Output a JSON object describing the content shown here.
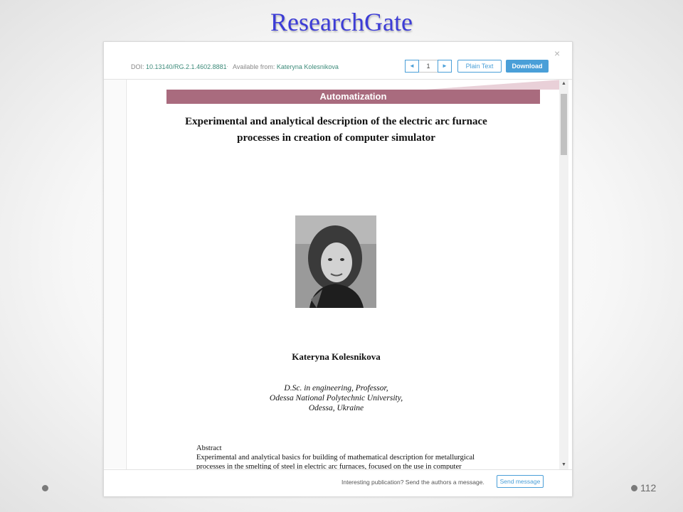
{
  "slide": {
    "title": "ResearchGate",
    "page_number": "112"
  },
  "viewer": {
    "doi_label": "DOI: ",
    "doi_value": "10.13140/RG.2.1.4602.8881",
    "separator": "·",
    "available_label": "Available from: ",
    "available_value": "Kateryna Kolesnikova",
    "pager": {
      "prev_icon": "◄",
      "current_page": "1",
      "next_icon": "►"
    },
    "plain_text_label": "Plain Text",
    "download_label": "Download",
    "close_icon": "×",
    "footer": {
      "message": "Interesting publication? Send the authors a message.",
      "send_label": "Send message"
    },
    "scroll_up_icon": "▲",
    "scroll_down_icon": "▼"
  },
  "document": {
    "section_header": "Automatization",
    "title_line1": "Experimental and analytical description of the electric arc furnace",
    "title_line2": "processes in creation of computer simulator",
    "author": "Kateryna Kolesnikova",
    "affiliation_line1": "D.Sc. in engineering, Professor,",
    "affiliation_line2": "Odessa National Polytechnic University,",
    "affiliation_line3": "Odessa, Ukraine",
    "abstract_heading": "Abstract",
    "abstract_line1": "Experimental and analytical basics for building of mathematical description for metallurgical",
    "abstract_line2": "processes in the smelting of steel in electric arc furnaces, focused on the use in computer"
  },
  "colors": {
    "title_blue": "#3c3cd6",
    "section_band": "#a96b7e",
    "link_teal": "#3d8b7a",
    "button_blue": "#4a9fd8"
  }
}
